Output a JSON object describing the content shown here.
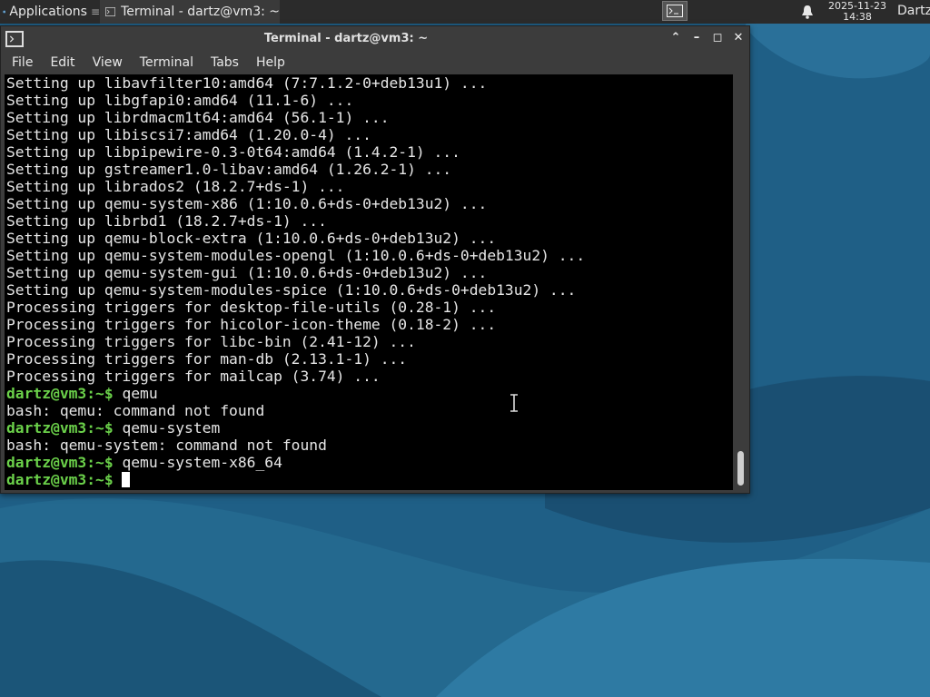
{
  "panel": {
    "applications_label": "Applications",
    "task_title": "Terminal - dartz@vm3: ~",
    "clock_date": "2025-11-23",
    "clock_time": "14:38",
    "user": "Dartz"
  },
  "window": {
    "title": "Terminal - dartz@vm3: ~",
    "menu": [
      "File",
      "Edit",
      "View",
      "Terminal",
      "Tabs",
      "Help"
    ]
  },
  "terminal": {
    "lines": [
      {
        "type": "out",
        "text": "Setting up libavfilter10:amd64 (7:7.1.2-0+deb13u1) ..."
      },
      {
        "type": "out",
        "text": "Setting up libgfapi0:amd64 (11.1-6) ..."
      },
      {
        "type": "out",
        "text": "Setting up librdmacm1t64:amd64 (56.1-1) ..."
      },
      {
        "type": "out",
        "text": "Setting up libiscsi7:amd64 (1.20.0-4) ..."
      },
      {
        "type": "out",
        "text": "Setting up libpipewire-0.3-0t64:amd64 (1.4.2-1) ..."
      },
      {
        "type": "out",
        "text": "Setting up gstreamer1.0-libav:amd64 (1.26.2-1) ..."
      },
      {
        "type": "out",
        "text": "Setting up librados2 (18.2.7+ds-1) ..."
      },
      {
        "type": "out",
        "text": "Setting up qemu-system-x86 (1:10.0.6+ds-0+deb13u2) ..."
      },
      {
        "type": "out",
        "text": "Setting up librbd1 (18.2.7+ds-1) ..."
      },
      {
        "type": "out",
        "text": "Setting up qemu-block-extra (1:10.0.6+ds-0+deb13u2) ..."
      },
      {
        "type": "out",
        "text": "Setting up qemu-system-modules-opengl (1:10.0.6+ds-0+deb13u2) ..."
      },
      {
        "type": "out",
        "text": "Setting up qemu-system-gui (1:10.0.6+ds-0+deb13u2) ..."
      },
      {
        "type": "out",
        "text": "Setting up qemu-system-modules-spice (1:10.0.6+ds-0+deb13u2) ..."
      },
      {
        "type": "out",
        "text": "Processing triggers for desktop-file-utils (0.28-1) ..."
      },
      {
        "type": "out",
        "text": "Processing triggers for hicolor-icon-theme (0.18-2) ..."
      },
      {
        "type": "out",
        "text": "Processing triggers for libc-bin (2.41-12) ..."
      },
      {
        "type": "out",
        "text": "Processing triggers for man-db (2.13.1-1) ..."
      },
      {
        "type": "out",
        "text": "Processing triggers for mailcap (3.74) ..."
      },
      {
        "type": "cmd",
        "prompt": "dartz@vm3:~$",
        "text": " qemu"
      },
      {
        "type": "out",
        "text": "bash: qemu: command not found"
      },
      {
        "type": "cmd",
        "prompt": "dartz@vm3:~$",
        "text": " qemu-system"
      },
      {
        "type": "out",
        "text": "bash: qemu-system: command not found"
      },
      {
        "type": "cmd",
        "prompt": "dartz@vm3:~$",
        "text": " qemu-system-x86_64"
      },
      {
        "type": "cmd",
        "prompt": "dartz@vm3:~$",
        "text": " ",
        "cursor": true
      }
    ]
  },
  "colors": {
    "terminal_bg": "#000000",
    "terminal_fg": "#e6e6e6",
    "prompt": "#6bd14a",
    "panel_bg": "#2b2b2b",
    "window_bg": "#3c3c3c",
    "wallpaper": "#1f5f86"
  },
  "icons": {
    "applications": "xfce-mouse-icon",
    "task_terminal": "terminal-icon",
    "notifications": "bell-icon"
  }
}
